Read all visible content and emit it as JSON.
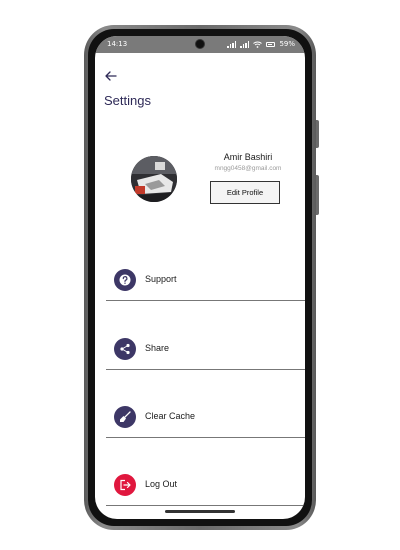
{
  "status_bar": {
    "time": "14:13",
    "battery": "59%"
  },
  "header": {
    "title": "Settings"
  },
  "profile": {
    "name": "Amir Bashiri",
    "email": "mngg0458@gmail.com",
    "edit_label": "Edit Profile"
  },
  "menu": [
    {
      "label": "Support",
      "icon": "help-icon",
      "color": "#3d3766"
    },
    {
      "label": "Share",
      "icon": "share-icon",
      "color": "#3d3766"
    },
    {
      "label": "Clear Cache",
      "icon": "broom-icon",
      "color": "#3d3766"
    },
    {
      "label": "Log Out",
      "icon": "logout-icon",
      "color": "#e0173e"
    }
  ]
}
